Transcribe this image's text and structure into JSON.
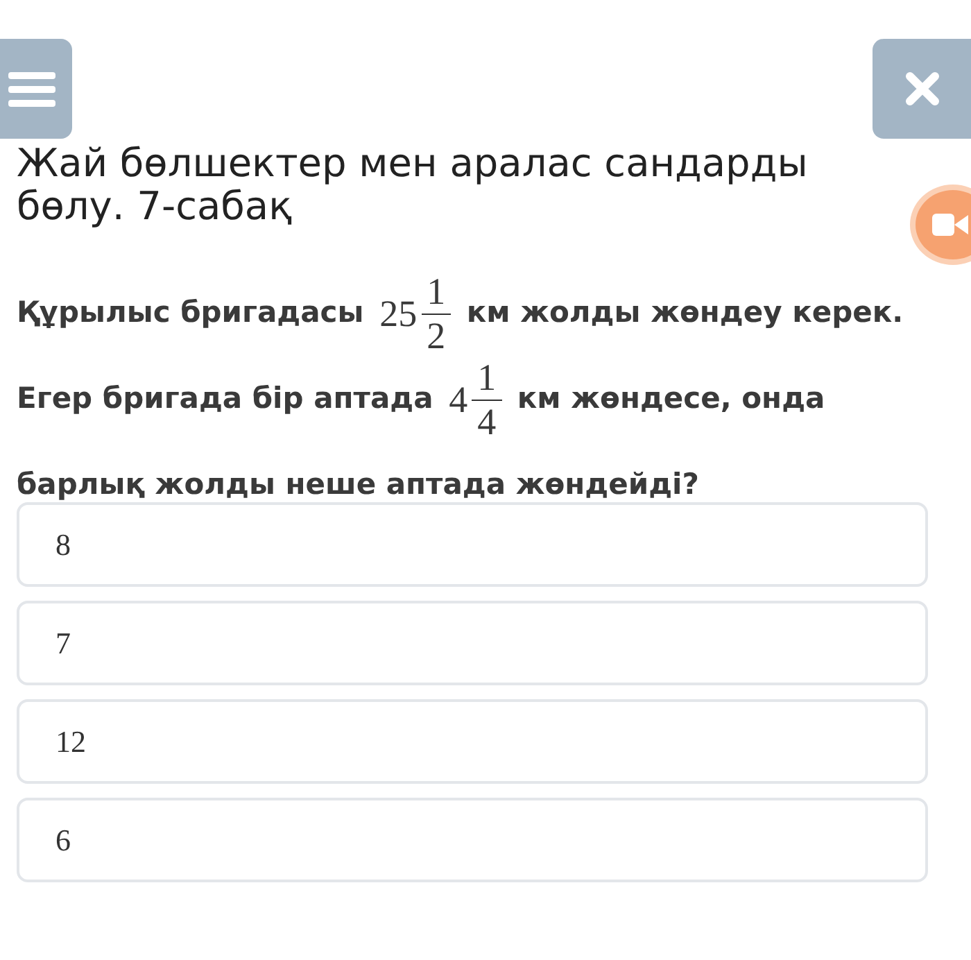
{
  "title": "Жай бөлшектер мен аралас сандарды бөлу. 7-сабақ",
  "question": [
    {
      "kind": "text",
      "text": "Құрылыс бригадасы "
    },
    {
      "kind": "mixed",
      "whole": "25",
      "numerator": "1",
      "denominator": "2"
    },
    {
      "kind": "text",
      "text": " км жолды жөндеу керек. Егер бригада бір аптада "
    },
    {
      "kind": "mixed",
      "whole": "4",
      "numerator": "1",
      "denominator": "4"
    },
    {
      "kind": "text",
      "text": " км жөндесе, онда барлық жолды неше аптада жөндейді?"
    }
  ],
  "options": [
    {
      "label": "8"
    },
    {
      "label": "7"
    },
    {
      "label": "12"
    },
    {
      "label": "6"
    }
  ]
}
